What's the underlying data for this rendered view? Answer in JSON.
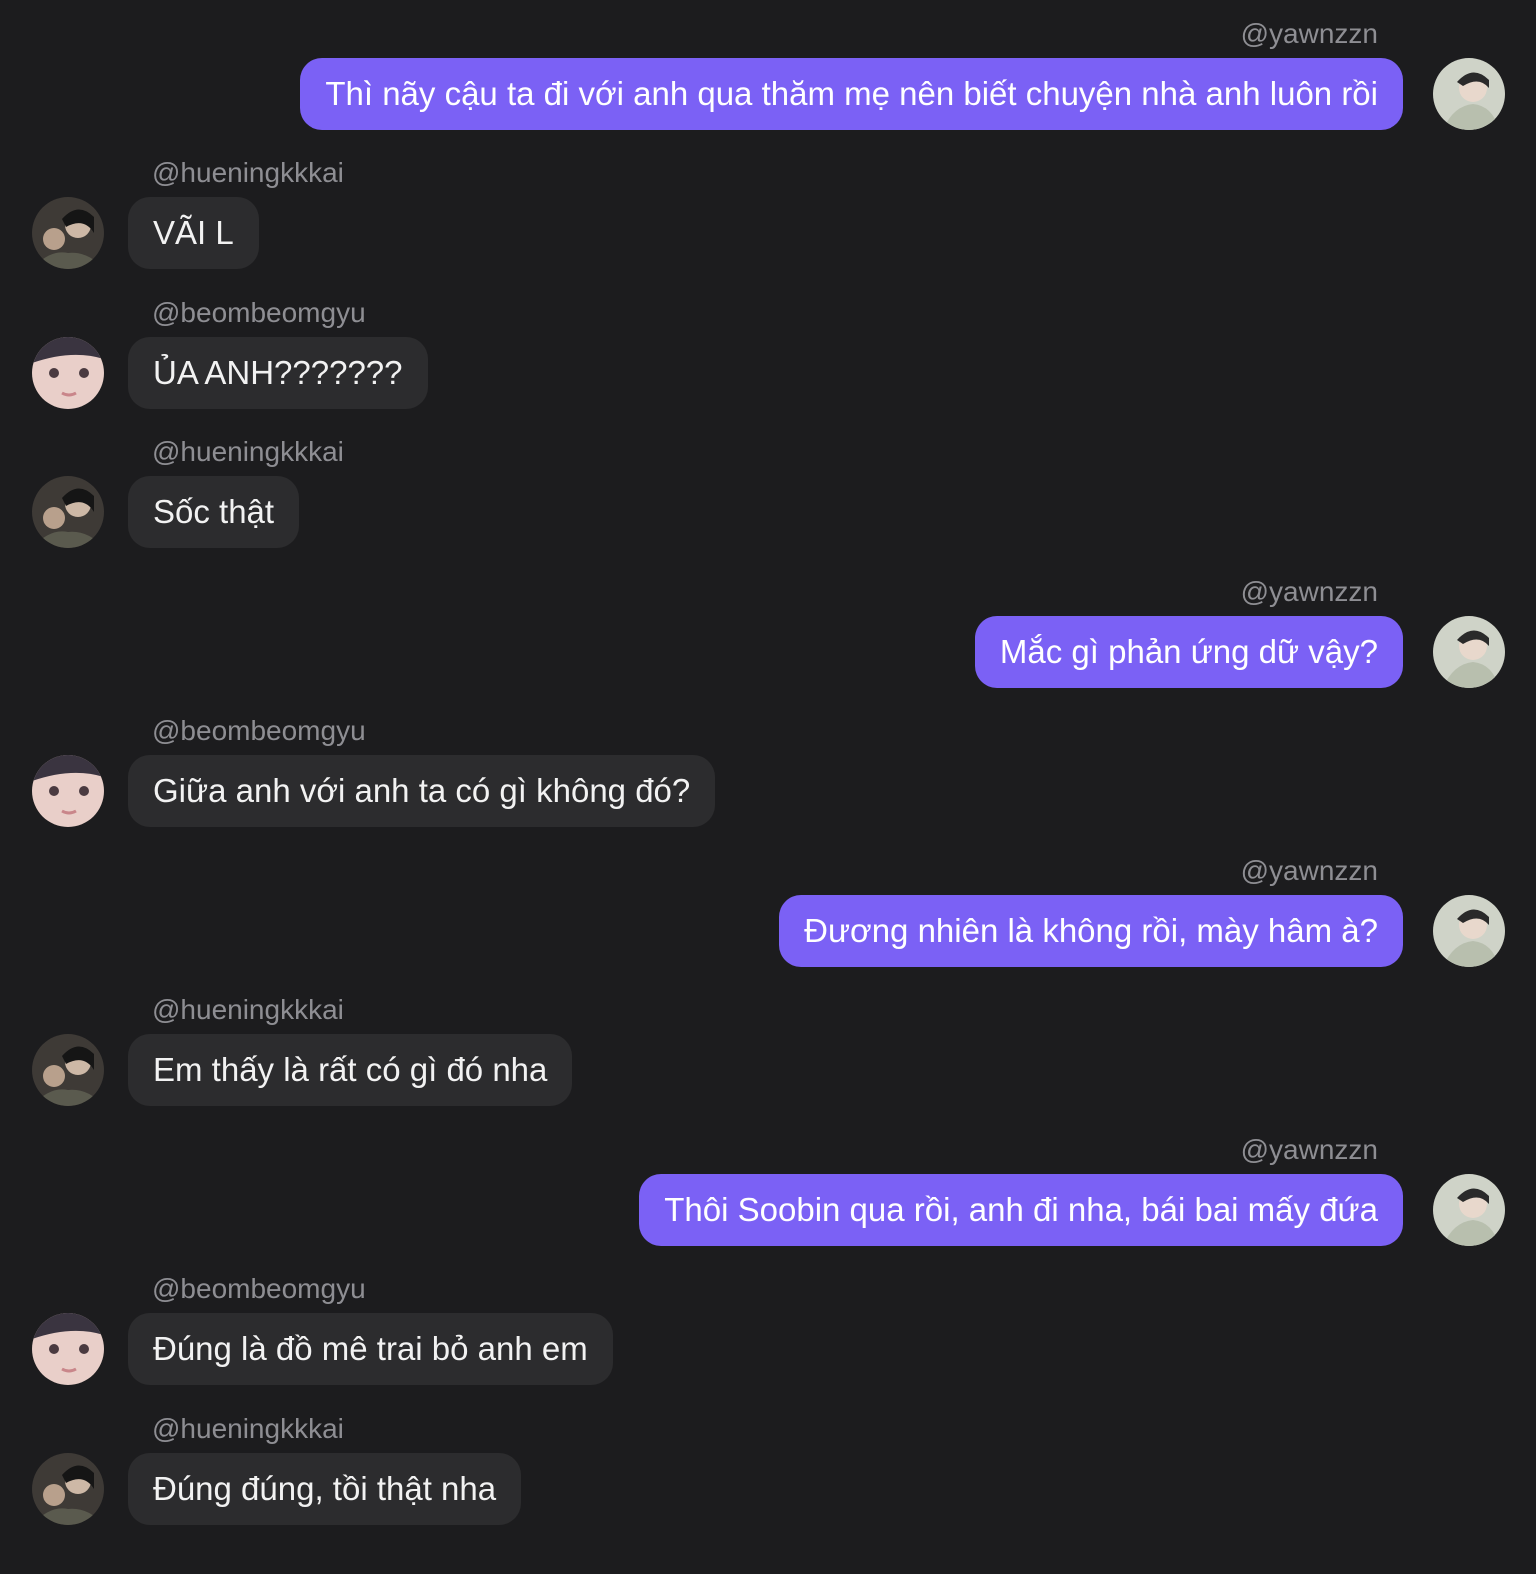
{
  "conversation": {
    "messages": [
      {
        "side": "right",
        "handle": "@yawnzzn",
        "text": "Thì nãy cậu ta đi với anh qua thăm mẹ nên biết chuyện nhà anh luôn rồi",
        "avatar": "avatar-yawnzzn"
      },
      {
        "side": "left",
        "handle": "@hueningkkkai",
        "text": "VÃI L",
        "avatar": "avatar-hueningkkkai"
      },
      {
        "side": "left",
        "handle": "@beombeomgyu",
        "text": "ỦA ANH???????",
        "avatar": "avatar-beombeomgyu"
      },
      {
        "side": "left",
        "handle": "@hueningkkkai",
        "text": "Sốc thật",
        "avatar": "avatar-hueningkkkai"
      },
      {
        "side": "right",
        "handle": "@yawnzzn",
        "text": "Mắc gì phản ứng dữ vậy?",
        "avatar": "avatar-yawnzzn"
      },
      {
        "side": "left",
        "handle": "@beombeomgyu",
        "text": "Giữa anh với anh ta có gì không đó?",
        "avatar": "avatar-beombeomgyu"
      },
      {
        "side": "right",
        "handle": "@yawnzzn",
        "text": "Đương nhiên là không rồi, mày hâm à?",
        "avatar": "avatar-yawnzzn"
      },
      {
        "side": "left",
        "handle": "@hueningkkkai",
        "text": "Em thấy là rất có gì đó nha",
        "avatar": "avatar-hueningkkkai"
      },
      {
        "side": "right",
        "handle": "@yawnzzn",
        "text": "Thôi Soobin qua rồi, anh đi nha, bái bai mấy đứa",
        "avatar": "avatar-yawnzzn"
      },
      {
        "side": "left",
        "handle": "@beombeomgyu",
        "text": "Đúng là đồ mê trai bỏ anh em",
        "avatar": "avatar-beombeomgyu"
      },
      {
        "side": "left",
        "handle": "@hueningkkkai",
        "text": "Đúng đúng, tồi thật nha",
        "avatar": "avatar-hueningkkkai"
      }
    ]
  },
  "colors": {
    "background": "#1c1c1e",
    "outgoing_bubble": "#7b61f5",
    "incoming_bubble": "#2c2c2e",
    "handle_text": "#8e8e93"
  }
}
